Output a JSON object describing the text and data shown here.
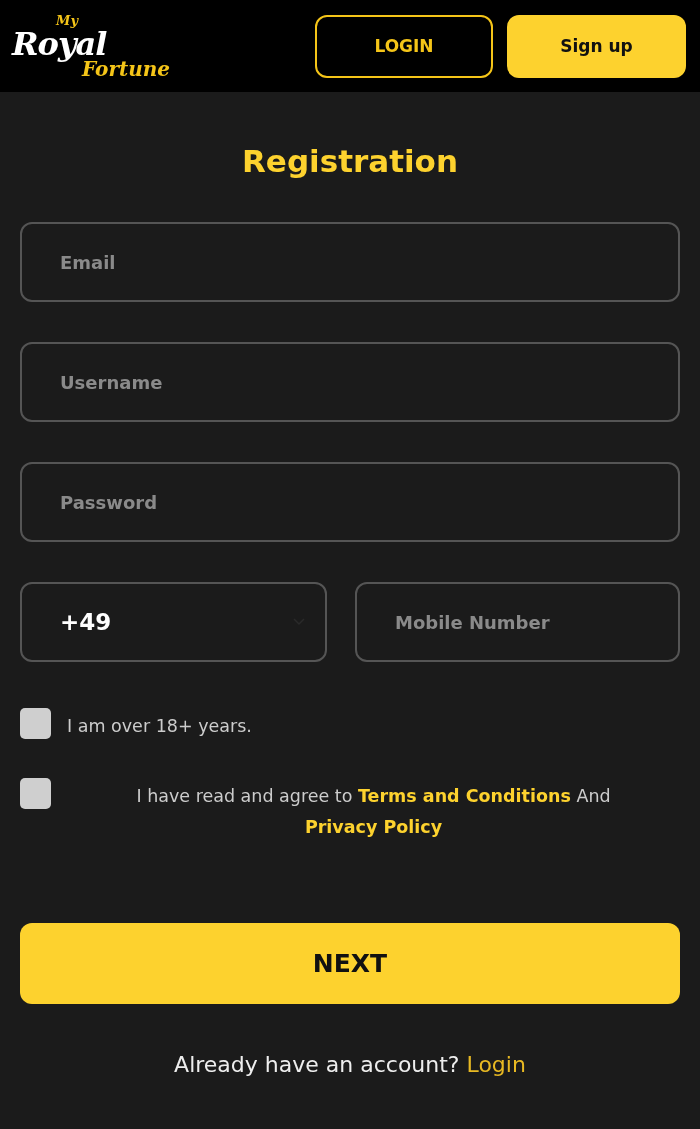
{
  "header": {
    "logo": {
      "top": "My",
      "main": "Royal",
      "sub": "Fortune"
    },
    "buttons": [
      {
        "label": "LOGIN",
        "kind": "outline"
      },
      {
        "label": "Sign up",
        "kind": "filled"
      }
    ]
  },
  "title": "Registration",
  "fields": [
    {
      "placeholder": "Email"
    },
    {
      "placeholder": "Username"
    },
    {
      "placeholder": "Password"
    }
  ],
  "phone": {
    "code": "+49",
    "placeholder": "Mobile Number"
  },
  "checks": [
    {
      "checked": false,
      "parts": [
        {
          "kind": "text",
          "text": "I am over 18+ years."
        }
      ],
      "kind": "plain"
    },
    {
      "checked": false,
      "parts": [
        {
          "kind": "text",
          "text": "I have read and agree to "
        },
        {
          "kind": "link",
          "text": "Terms and Conditions"
        },
        {
          "kind": "text",
          "text": " And "
        },
        {
          "kind": "link",
          "text": "Privacy Policy"
        }
      ],
      "kind": "centered"
    }
  ],
  "next": "NEXT",
  "footer": {
    "text": "Already have an account?",
    "link": "Login"
  }
}
